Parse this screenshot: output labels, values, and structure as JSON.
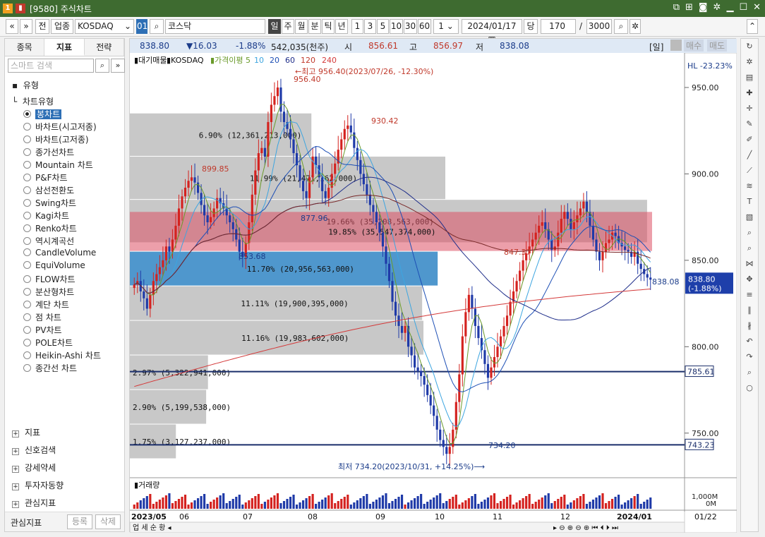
{
  "window": {
    "title_badge": "1",
    "title": "[9580] 주식차트"
  },
  "toolbar": {
    "nav_prev": "«",
    "nav_dropdown": "»",
    "prev_label": "전",
    "sector_label": "업종",
    "market": "KOSDAQ",
    "code": "01",
    "name": "코스닥",
    "periods": [
      "일",
      "주",
      "월",
      "분",
      "틱",
      "년"
    ],
    "multipliers": [
      "1",
      "3",
      "5",
      "10",
      "30",
      "60"
    ],
    "mult_selected": "1",
    "date": "2024/01/17",
    "unit_label": "당",
    "count": "170",
    "slash": "/",
    "total": "3000"
  },
  "left": {
    "tabs": [
      "종목",
      "지표",
      "전략"
    ],
    "search_placeholder": "스마트 검색",
    "section_header": "유형",
    "tree_parent": "차트유형",
    "chart_types": [
      "봉차트",
      "바차트(시고저종)",
      "바차트(고저종)",
      "종가선차트",
      "Mountain 차트",
      "P&F차트",
      "삼선전환도",
      "Swing차트",
      "Kagi차트",
      "Renko차트",
      "역시계곡선",
      "CandleVolume",
      "EquiVolume",
      "FLOW차트",
      "분산형차트",
      "계단 차트",
      "점 차트",
      "PV차트",
      "POLE차트",
      "Heikin-Ashi 차트",
      "종간선 차트"
    ],
    "selected_type": "봉차트",
    "sections": [
      "지표",
      "신호검색",
      "강세약세",
      "투자자동향",
      "관심지표"
    ],
    "bottom_label": "관심지표",
    "btn_register": "등록",
    "btn_delete": "삭제"
  },
  "info": {
    "price": "838.80",
    "change": "▼16.03",
    "pct": "-1.88%",
    "volume": "542,035(천주)",
    "open_label": "시",
    "open": "856.61",
    "high_label": "고",
    "high": "856.97",
    "low_label": "저",
    "low": "838.08",
    "period_tag": "[일]",
    "buy_label": "매수",
    "sell_label": "매도"
  },
  "legend": {
    "candle": "대기매물",
    "name": "KOSDAQ",
    "ma_label": "가격이평",
    "ma": [
      "5",
      "10",
      "20",
      "60",
      "120",
      "240"
    ]
  },
  "annotations": {
    "high_note": "←최고 956.40(2023/07/26, -12.30%)",
    "low_note": "최저 734.20(2023/10/31, +14.25%)⟶",
    "hl": "HL -23.23%",
    "labels": [
      "956.40",
      "930.42",
      "899.85",
      "877.96",
      "853.68",
      "847.37",
      "838.08",
      "734.20"
    ]
  },
  "price_axis": [
    "950.00",
    "900.00",
    "850.00",
    "800.00",
    "750.00"
  ],
  "current_price_box": [
    "838.80",
    "(-1.88%)"
  ],
  "hlines": [
    "785.61",
    "743.23"
  ],
  "date_axis": [
    "2023/05",
    "06",
    "07",
    "08",
    "09",
    "10",
    "11",
    "12",
    "2024/01",
    "01/22"
  ],
  "volume_panel": {
    "title": "거래량",
    "axis": [
      "1,000M",
      "0M"
    ]
  },
  "chart_data": {
    "type": "candlestick",
    "ylim": [
      725,
      970
    ],
    "volume_profile": [
      {
        "label": "6.90% (12,361,213,000)",
        "price_from": 910,
        "price_to": 935,
        "pct": 6.9
      },
      {
        "label": "11.99% (21,471,162,000)",
        "price_from": 885,
        "price_to": 910,
        "pct": 11.99
      },
      {
        "label": "19.66% (35,208,563,000)",
        "price_from": 860,
        "price_to": 885,
        "pct": 19.66
      },
      {
        "label": "19.85% (35,547,374,000)",
        "price_from": 855,
        "price_to": 878,
        "pct": 19.85
      },
      {
        "label": "11.70% (20,956,563,000)",
        "price_from": 835,
        "price_to": 855,
        "pct": 11.7
      },
      {
        "label": "11.11% (19,900,395,000)",
        "price_from": 815,
        "price_to": 835,
        "pct": 11.11
      },
      {
        "label": "11.16% (19,983,602,000)",
        "price_from": 795,
        "price_to": 815,
        "pct": 11.16
      },
      {
        "label": "2.97% (5,322,941,000)",
        "price_from": 775,
        "price_to": 795,
        "pct": 2.97
      },
      {
        "label": "2.90% (5,199,538,000)",
        "price_from": 755,
        "price_to": 775,
        "pct": 2.9
      },
      {
        "label": "1.75% (3,127,237,000)",
        "price_from": 735,
        "price_to": 755,
        "pct": 1.75
      }
    ],
    "close": [
      836,
      838,
      832,
      828,
      822,
      830,
      838,
      842,
      846,
      850,
      858,
      855,
      862,
      870,
      880,
      887,
      892,
      896,
      898,
      895,
      889,
      882,
      876,
      872,
      875,
      880,
      886,
      883,
      880,
      876,
      872,
      868,
      862,
      855,
      852,
      860,
      872,
      888,
      902,
      912,
      915,
      910,
      930,
      940,
      945,
      950,
      936,
      930,
      926,
      920,
      912,
      905,
      896,
      890,
      886,
      898,
      910,
      905,
      898,
      890,
      886,
      892,
      900,
      906,
      914,
      920,
      926,
      928,
      924,
      915,
      908,
      900,
      894,
      888,
      882,
      878,
      872,
      866,
      858,
      848,
      838,
      826,
      818,
      812,
      808,
      812,
      800,
      795,
      788,
      786,
      783,
      778,
      772,
      766,
      760,
      752,
      746,
      742,
      738,
      742,
      752,
      768,
      784,
      806,
      820,
      830,
      822,
      812,
      805,
      798,
      790,
      782,
      788,
      794,
      800,
      806,
      812,
      818,
      826,
      832,
      838,
      844,
      850,
      854,
      858,
      862,
      866,
      870,
      872,
      868,
      862,
      856,
      858,
      866,
      874,
      878,
      874,
      868,
      872,
      876,
      880,
      884,
      878,
      870,
      862,
      855,
      850,
      855,
      860,
      862,
      866,
      864,
      860,
      858,
      856,
      855,
      852,
      855,
      848,
      845,
      842,
      840,
      838.8
    ],
    "ma_long": "240-day moving average (red)"
  }
}
